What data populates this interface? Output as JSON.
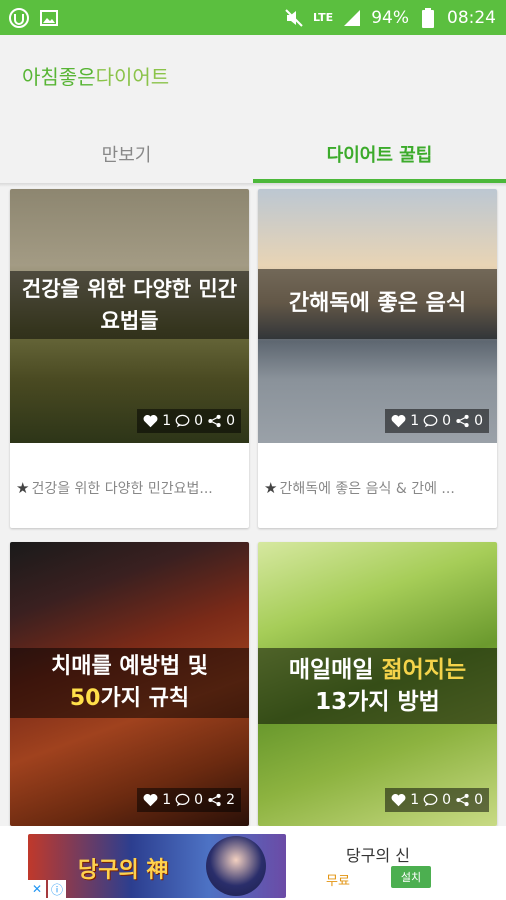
{
  "status": {
    "battery": "94%",
    "time": "08:24",
    "network": "LTE"
  },
  "header": {
    "logo_part1": "아침좋은",
    "logo_part2": "다이어트"
  },
  "tabs": [
    {
      "label": "만보기",
      "active": false
    },
    {
      "label": "다이어트 꿀팁",
      "active": true
    }
  ],
  "cards": [
    {
      "overlay_line1": "건강을 위한 다양한 민간",
      "overlay_line2": "요법들",
      "likes": "1",
      "comments": "0",
      "shares": "0",
      "caption": "건강을 위한 다양한 민간요법..."
    },
    {
      "overlay_line1": "간해독에 좋은 음식",
      "likes": "1",
      "comments": "0",
      "shares": "0",
      "caption": "간해독에 좋은 음식 & 간에 ..."
    },
    {
      "overlay_line1": "치매를 예방법 및",
      "overlay_line2_hl": "50",
      "overlay_line2_rest": "가지 규칙",
      "likes": "1",
      "comments": "0",
      "shares": "2"
    },
    {
      "overlay_line1_a": "매일매일 ",
      "overlay_line1_hl": "젊어지는",
      "overlay_line2": "13가지 방법",
      "likes": "1",
      "comments": "0",
      "shares": "0"
    }
  ],
  "ad": {
    "banner_title": "당구의 神",
    "app_name": "당구의 신",
    "price": "무료",
    "install": "설치"
  },
  "colors": {
    "brand": "#5bbf3f",
    "tab_active": "#3cab2b"
  }
}
